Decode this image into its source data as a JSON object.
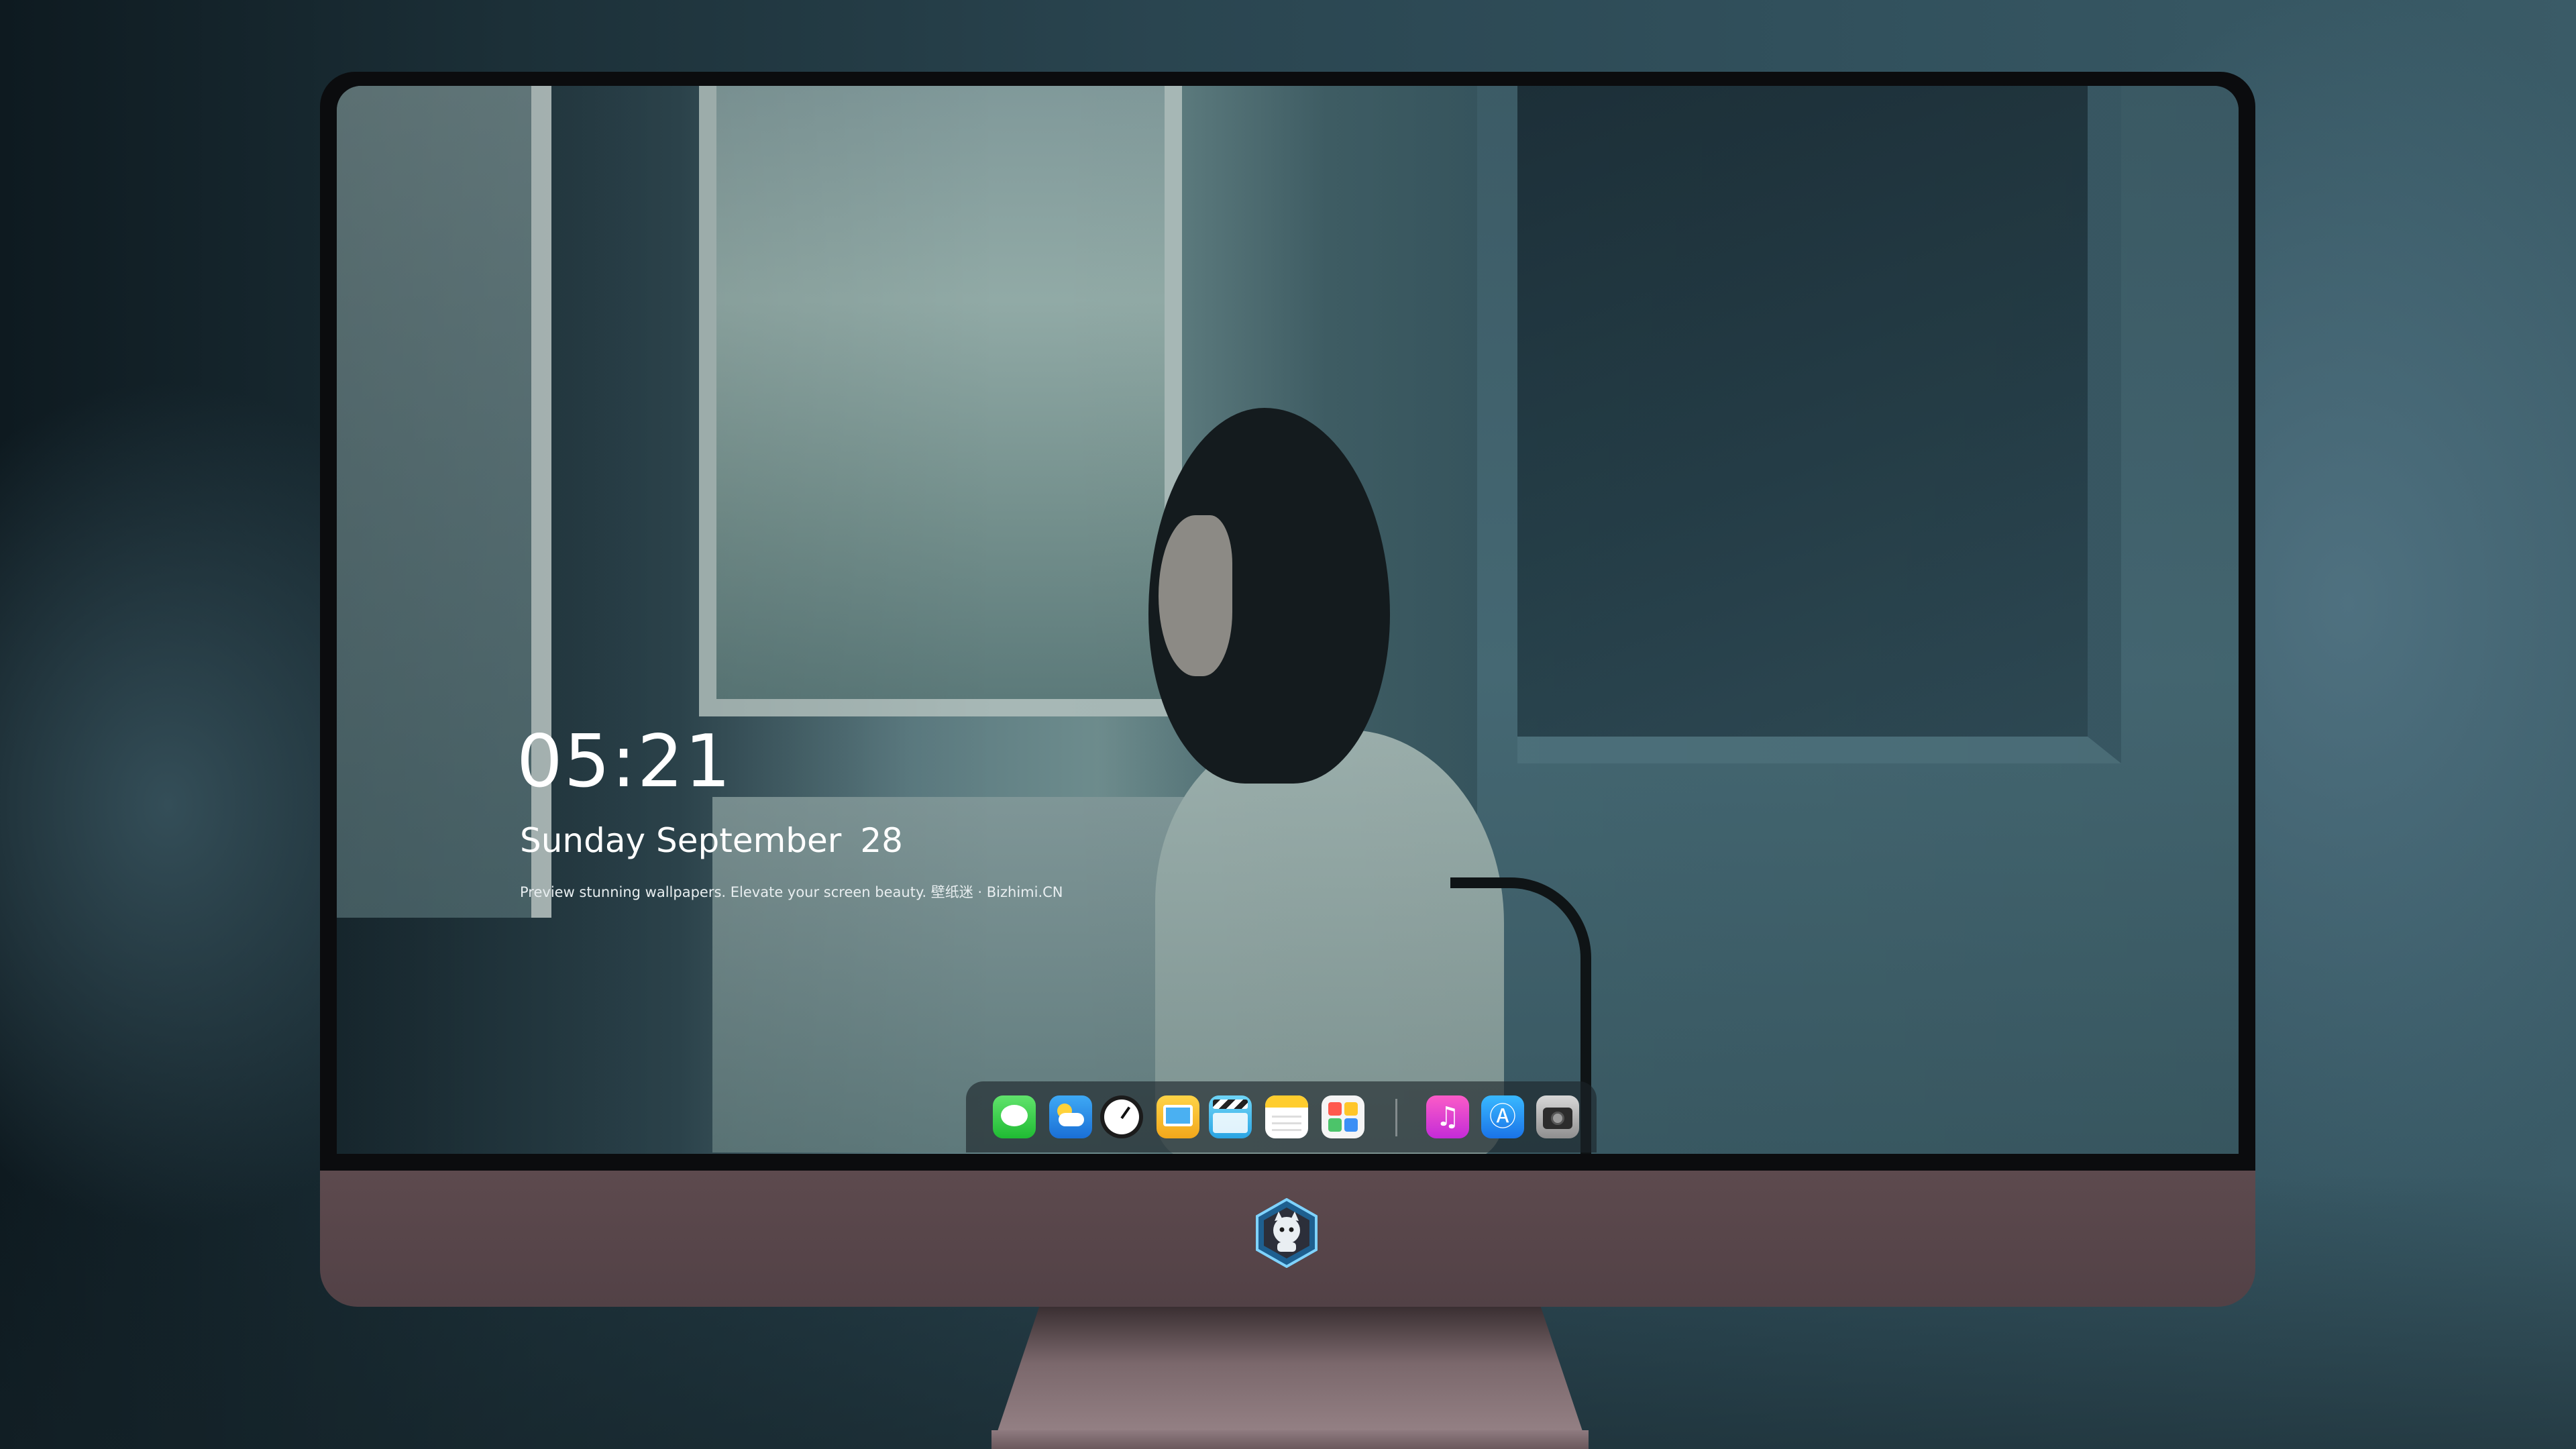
{
  "lock_screen": {
    "time": "05:21",
    "weekday_month": "Sunday September",
    "day": "28",
    "caption": "Preview stunning wallpapers. Elevate your screen beauty. 壁纸迷 · Bizhimi.CN"
  },
  "dock": {
    "items": [
      {
        "name": "messages-icon",
        "glyph": ""
      },
      {
        "name": "weather-icon",
        "glyph": ""
      },
      {
        "name": "clock-icon",
        "glyph": ""
      },
      {
        "name": "preview-icon",
        "glyph": ""
      },
      {
        "name": "clips-icon",
        "glyph": ""
      },
      {
        "name": "notes-icon",
        "glyph": ""
      },
      {
        "name": "photos-icon",
        "glyph": ""
      },
      {
        "name": "music-icon",
        "glyph": "♫"
      },
      {
        "name": "app-store-icon",
        "glyph": "Ⓐ"
      },
      {
        "name": "camera-icon",
        "glyph": ""
      }
    ]
  },
  "colors": {
    "monitor_body": "#5d4a4e",
    "bezel": "#0b0c0e",
    "text": "#ffffff"
  }
}
